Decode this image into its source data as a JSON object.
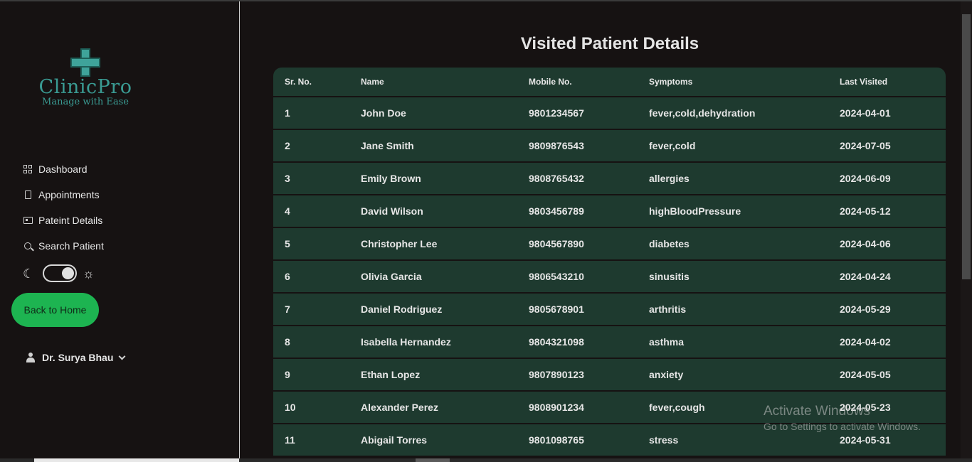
{
  "brand": {
    "title": "ClinicPro",
    "subtitle": "Manage with Ease"
  },
  "nav": [
    {
      "label": "Dashboard",
      "icon": "dashboard-grid-icon"
    },
    {
      "label": "Appointments",
      "icon": "clipboard-icon"
    },
    {
      "label": "Pateint Details",
      "icon": "id-card-icon"
    },
    {
      "label": "Search Patient",
      "icon": "search-icon"
    }
  ],
  "theme": {
    "dark_icon": "moon-icon",
    "light_icon": "sun-icon",
    "toggle_state": "light"
  },
  "back_button": "Back to Home",
  "user": {
    "name": "Dr. Surya Bhau"
  },
  "page_title": "Visited Patient Details",
  "table": {
    "columns": [
      "Sr. No.",
      "Name",
      "Mobile No.",
      "Symptoms",
      "Last Visited"
    ],
    "rows": [
      [
        "1",
        "John Doe",
        "9801234567",
        "fever,cold,dehydration",
        "2024-04-01"
      ],
      [
        "2",
        "Jane Smith",
        "9809876543",
        "fever,cold",
        "2024-07-05"
      ],
      [
        "3",
        "Emily Brown",
        "9808765432",
        "allergies",
        "2024-06-09"
      ],
      [
        "4",
        "David Wilson",
        "9803456789",
        "highBloodPressure",
        "2024-05-12"
      ],
      [
        "5",
        "Christopher Lee",
        "9804567890",
        "diabetes",
        "2024-04-06"
      ],
      [
        "6",
        "Olivia Garcia",
        "9806543210",
        "sinusitis",
        "2024-04-24"
      ],
      [
        "7",
        "Daniel Rodriguez",
        "9805678901",
        "arthritis",
        "2024-05-29"
      ],
      [
        "8",
        "Isabella Hernandez",
        "9804321098",
        "asthma",
        "2024-04-02"
      ],
      [
        "9",
        "Ethan Lopez",
        "9807890123",
        "anxiety",
        "2024-05-05"
      ],
      [
        "10",
        "Alexander Perez",
        "9808901234",
        "fever,cough",
        "2024-05-23"
      ],
      [
        "11",
        "Abigail Torres",
        "9801098765",
        "stress",
        "2024-05-31"
      ]
    ]
  },
  "watermark": {
    "line1": "Activate Windows",
    "line2": "Go to Settings to activate Windows."
  },
  "colors": {
    "accent": "#1db451",
    "table_bg": "#1e3a2f",
    "brand": "#3a9b93",
    "background": "#161212"
  }
}
